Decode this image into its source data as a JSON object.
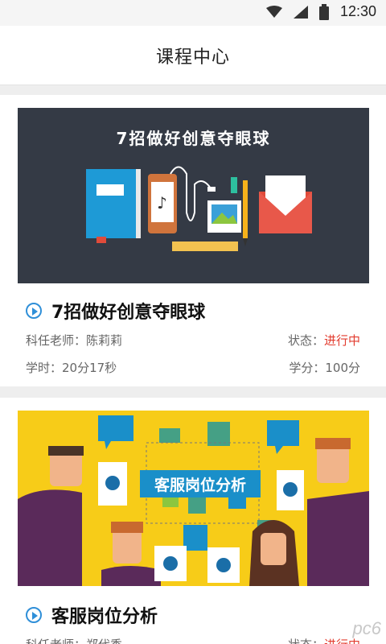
{
  "status_bar": {
    "time": "12:30"
  },
  "header": {
    "title": "课程中心"
  },
  "courses": [
    {
      "banner_text": "7招做好创意夺眼球",
      "title": "7招做好创意夺眼球",
      "teacher_label": "科任老师：陈莉莉",
      "status_label": "状态：",
      "status_value": "进行中",
      "hours_label": "学时：20分17秒",
      "credit_label": "学分：100分"
    },
    {
      "banner_text": "客服岗位分析",
      "title": "客服岗位分析",
      "teacher_label": "科任老师：郑代秀",
      "status_label": "状态：",
      "status_value": "进行中"
    }
  ],
  "watermark": "pc6",
  "colors": {
    "accent_blue": "#2f8fd8",
    "status_red": "#e23b2e",
    "banner1_bg": "#343a45",
    "banner2_bg": "#f7cc18"
  }
}
